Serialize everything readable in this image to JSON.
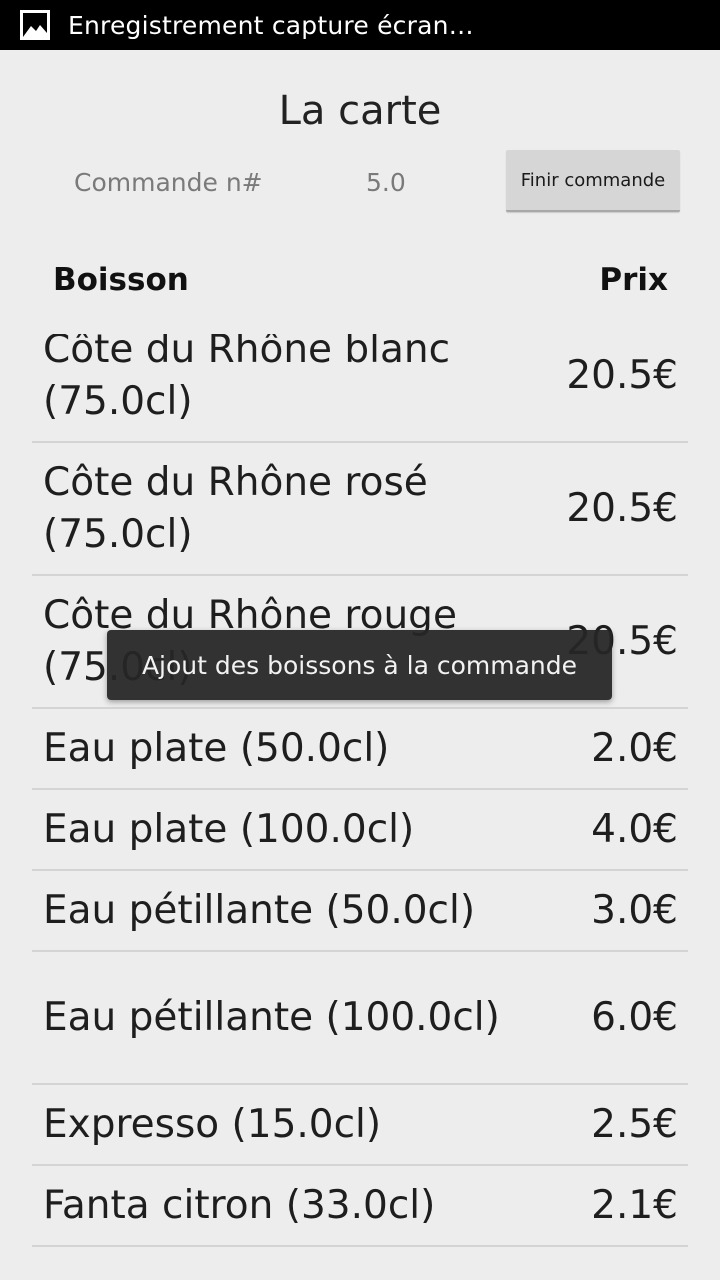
{
  "status_bar": {
    "notification_icon": "image-icon",
    "notification_text": "Enregistrement capture écran…"
  },
  "header": {
    "title": "La carte",
    "order_label": "Commande n#",
    "order_number": "5.0",
    "finish_button": "Finir commande"
  },
  "columns": {
    "name": "Boisson",
    "price": "Prix"
  },
  "drinks": [
    {
      "name": "Côte du Rhône blanc (75.0cl)",
      "price": "20.5€"
    },
    {
      "name": "Côte du Rhône rosé (75.0cl)",
      "price": "20.5€"
    },
    {
      "name": "Côte du Rhône rouge (75.0cl)",
      "price": "20.5€"
    },
    {
      "name": "Eau plate (50.0cl)",
      "price": "2.0€"
    },
    {
      "name": "Eau plate (100.0cl)",
      "price": "4.0€"
    },
    {
      "name": "Eau pétillante (50.0cl)",
      "price": "3.0€"
    },
    {
      "name": "Eau pétillante (100.0cl)",
      "price": "6.0€"
    },
    {
      "name": "Expresso (15.0cl)",
      "price": "2.5€"
    },
    {
      "name": "Fanta citron (33.0cl)",
      "price": "2.1€"
    }
  ],
  "toast": {
    "message": "Ajout des boissons à la commande"
  }
}
